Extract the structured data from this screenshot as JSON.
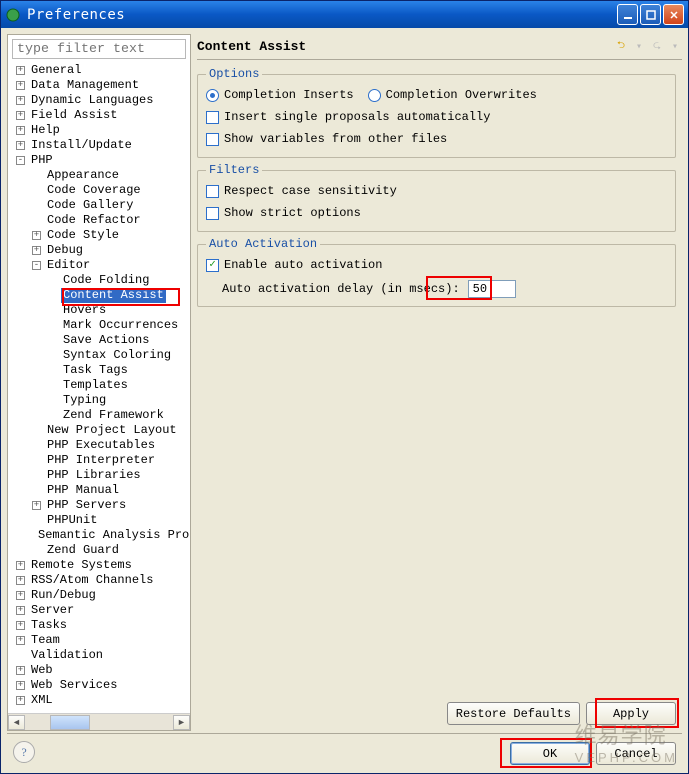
{
  "window": {
    "title": "Preferences"
  },
  "left": {
    "filter_placeholder": "type filter text",
    "tree": [
      {
        "d": 0,
        "t": "+",
        "l": "General"
      },
      {
        "d": 0,
        "t": "+",
        "l": "Data Management"
      },
      {
        "d": 0,
        "t": "+",
        "l": "Dynamic Languages"
      },
      {
        "d": 0,
        "t": "+",
        "l": "Field Assist"
      },
      {
        "d": 0,
        "t": "+",
        "l": "Help"
      },
      {
        "d": 0,
        "t": "+",
        "l": "Install/Update"
      },
      {
        "d": 0,
        "t": "-",
        "l": "PHP"
      },
      {
        "d": 1,
        "t": " ",
        "l": "Appearance"
      },
      {
        "d": 1,
        "t": " ",
        "l": "Code Coverage"
      },
      {
        "d": 1,
        "t": " ",
        "l": "Code Gallery"
      },
      {
        "d": 1,
        "t": " ",
        "l": "Code Refactor"
      },
      {
        "d": 1,
        "t": "+",
        "l": "Code Style"
      },
      {
        "d": 1,
        "t": "+",
        "l": "Debug"
      },
      {
        "d": 1,
        "t": "-",
        "l": "Editor"
      },
      {
        "d": 2,
        "t": " ",
        "l": "Code Folding"
      },
      {
        "d": 2,
        "t": " ",
        "l": "Content Assist",
        "sel": true
      },
      {
        "d": 2,
        "t": " ",
        "l": "Hovers"
      },
      {
        "d": 2,
        "t": " ",
        "l": "Mark Occurrences"
      },
      {
        "d": 2,
        "t": " ",
        "l": "Save Actions"
      },
      {
        "d": 2,
        "t": " ",
        "l": "Syntax Coloring"
      },
      {
        "d": 2,
        "t": " ",
        "l": "Task Tags"
      },
      {
        "d": 2,
        "t": " ",
        "l": "Templates"
      },
      {
        "d": 2,
        "t": " ",
        "l": "Typing"
      },
      {
        "d": 2,
        "t": " ",
        "l": "Zend Framework"
      },
      {
        "d": 1,
        "t": " ",
        "l": "New Project Layout"
      },
      {
        "d": 1,
        "t": " ",
        "l": "PHP Executables"
      },
      {
        "d": 1,
        "t": " ",
        "l": "PHP Interpreter"
      },
      {
        "d": 1,
        "t": " ",
        "l": "PHP Libraries"
      },
      {
        "d": 1,
        "t": " ",
        "l": "PHP Manual"
      },
      {
        "d": 1,
        "t": "+",
        "l": "PHP Servers"
      },
      {
        "d": 1,
        "t": " ",
        "l": "PHPUnit"
      },
      {
        "d": 1,
        "t": " ",
        "l": "Semantic Analysis Pro"
      },
      {
        "d": 1,
        "t": " ",
        "l": "Zend Guard"
      },
      {
        "d": 0,
        "t": "+",
        "l": "Remote Systems"
      },
      {
        "d": 0,
        "t": "+",
        "l": "RSS/Atom Channels"
      },
      {
        "d": 0,
        "t": "+",
        "l": "Run/Debug"
      },
      {
        "d": 0,
        "t": "+",
        "l": "Server"
      },
      {
        "d": 0,
        "t": "+",
        "l": "Tasks"
      },
      {
        "d": 0,
        "t": "+",
        "l": "Team"
      },
      {
        "d": 0,
        "t": " ",
        "l": "Validation"
      },
      {
        "d": 0,
        "t": "+",
        "l": "Web"
      },
      {
        "d": 0,
        "t": "+",
        "l": "Web Services"
      },
      {
        "d": 0,
        "t": "+",
        "l": "XML"
      }
    ]
  },
  "page": {
    "title": "Content Assist",
    "options": {
      "legend": "Options",
      "radio1": "Completion Inserts",
      "radio2": "Completion Overwrites",
      "chk1": "Insert single proposals automatically",
      "chk2": "Show variables from other files"
    },
    "filters": {
      "legend": "Filters",
      "chk1": "Respect case sensitivity",
      "chk2": "Show strict options"
    },
    "auto": {
      "legend": "Auto Activation",
      "enable": "Enable auto activation",
      "delay_label": "Auto activation delay (in msecs):",
      "delay_value": "50"
    },
    "buttons": {
      "restore": "Restore Defaults",
      "apply": "Apply",
      "ok": "OK",
      "cancel": "Cancel"
    }
  },
  "watermark": {
    "line1": "维易学院",
    "line2": "VEPHP.COM"
  }
}
